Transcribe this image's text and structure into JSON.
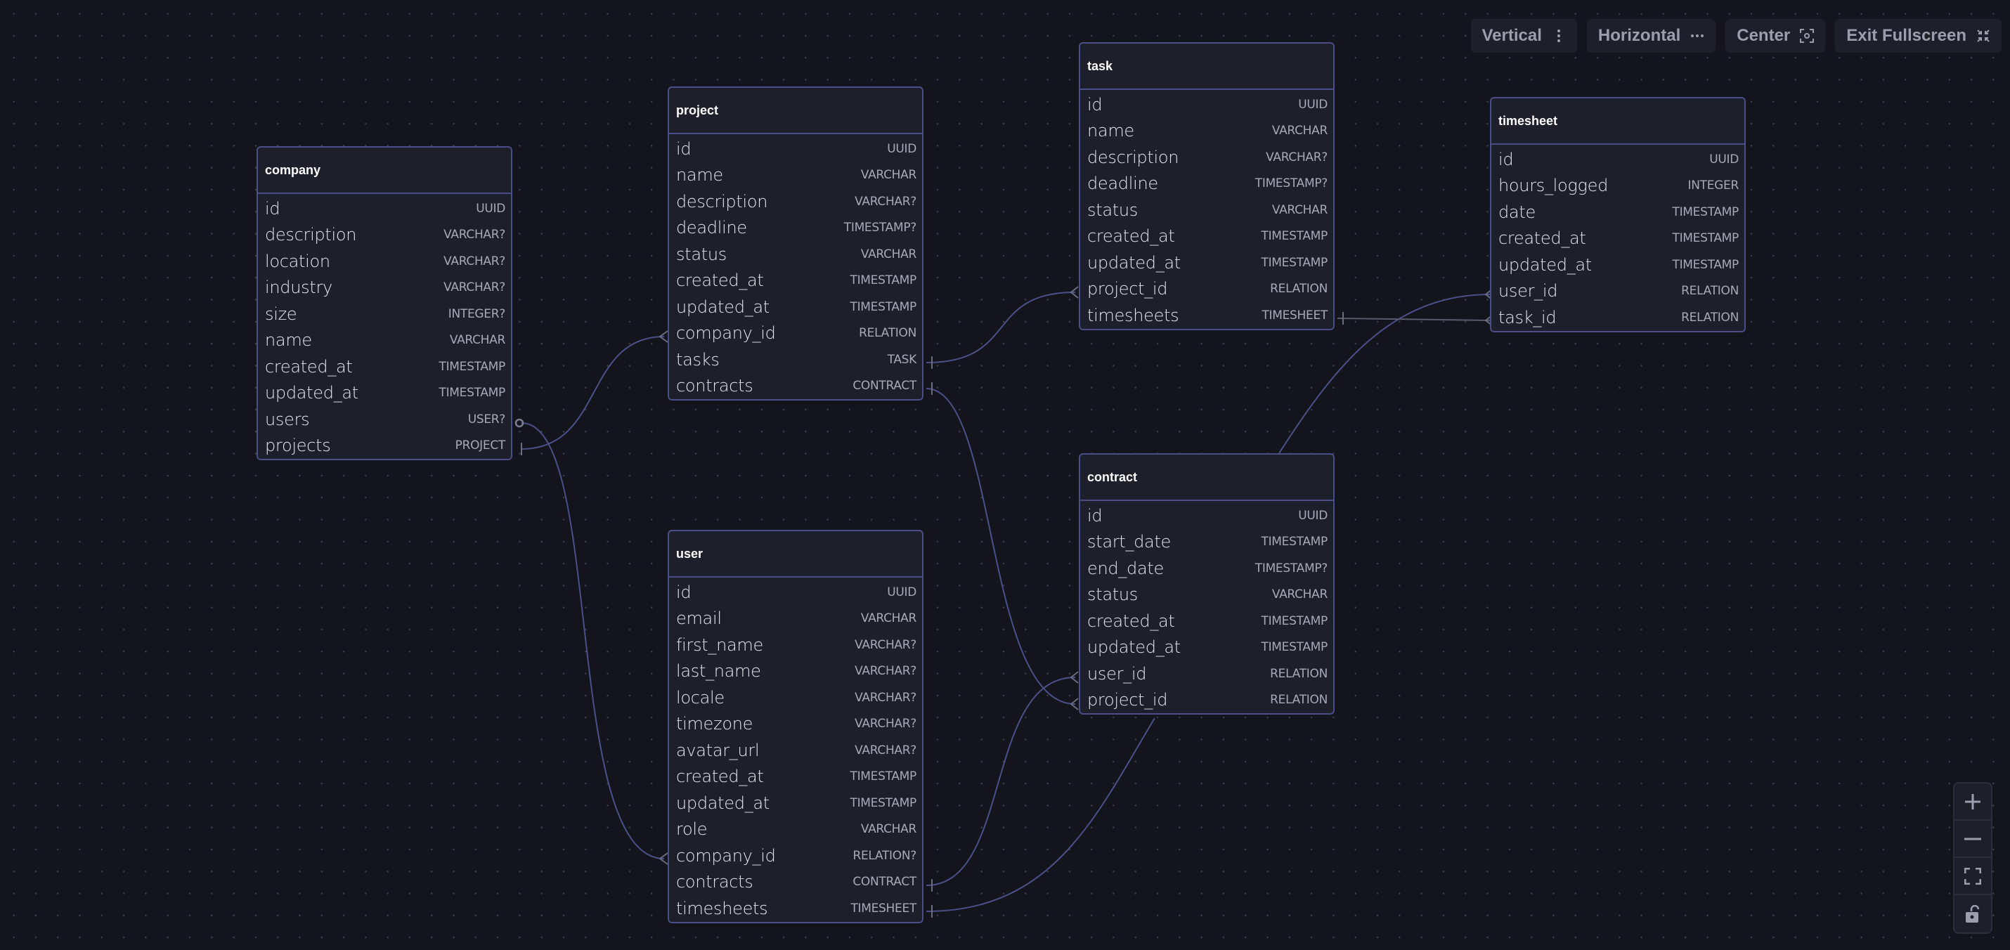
{
  "toolbar": {
    "vertical_label": "Vertical",
    "horizontal_label": "Horizontal",
    "center_label": "Center",
    "exit_fullscreen_label": "Exit Fullscreen",
    "icons": [
      "vertical-dots-icon",
      "horizontal-dots-icon",
      "focus-icon",
      "collapse-icon"
    ]
  },
  "zoom_controls": {
    "icons": [
      "zoom-in-icon",
      "zoom-out-icon",
      "fit-view-icon",
      "unlock-icon"
    ]
  },
  "colors": {
    "background": "#13141c",
    "table_bg": "#1d1f2b",
    "table_border": "#4a4e86",
    "edge": "#4b5088"
  },
  "tables": {
    "company": {
      "title": "company",
      "columns": [
        {
          "name": "id",
          "type": "UUID"
        },
        {
          "name": "description",
          "type": "VARCHAR?"
        },
        {
          "name": "location",
          "type": "VARCHAR?"
        },
        {
          "name": "industry",
          "type": "VARCHAR?"
        },
        {
          "name": "size",
          "type": "INTEGER?"
        },
        {
          "name": "name",
          "type": "VARCHAR"
        },
        {
          "name": "created_at",
          "type": "TIMESTAMP"
        },
        {
          "name": "updated_at",
          "type": "TIMESTAMP"
        },
        {
          "name": "users",
          "type": "USER?"
        },
        {
          "name": "projects",
          "type": "PROJECT"
        }
      ]
    },
    "project": {
      "title": "project",
      "columns": [
        {
          "name": "id",
          "type": "UUID"
        },
        {
          "name": "name",
          "type": "VARCHAR"
        },
        {
          "name": "description",
          "type": "VARCHAR?"
        },
        {
          "name": "deadline",
          "type": "TIMESTAMP?"
        },
        {
          "name": "status",
          "type": "VARCHAR"
        },
        {
          "name": "created_at",
          "type": "TIMESTAMP"
        },
        {
          "name": "updated_at",
          "type": "TIMESTAMP"
        },
        {
          "name": "company_id",
          "type": "RELATION"
        },
        {
          "name": "tasks",
          "type": "TASK"
        },
        {
          "name": "contracts",
          "type": "CONTRACT"
        }
      ]
    },
    "task": {
      "title": "task",
      "columns": [
        {
          "name": "id",
          "type": "UUID"
        },
        {
          "name": "name",
          "type": "VARCHAR"
        },
        {
          "name": "description",
          "type": "VARCHAR?"
        },
        {
          "name": "deadline",
          "type": "TIMESTAMP?"
        },
        {
          "name": "status",
          "type": "VARCHAR"
        },
        {
          "name": "created_at",
          "type": "TIMESTAMP"
        },
        {
          "name": "updated_at",
          "type": "TIMESTAMP"
        },
        {
          "name": "project_id",
          "type": "RELATION"
        },
        {
          "name": "timesheets",
          "type": "TIMESHEET"
        }
      ]
    },
    "timesheet": {
      "title": "timesheet",
      "columns": [
        {
          "name": "id",
          "type": "UUID"
        },
        {
          "name": "hours_logged",
          "type": "INTEGER"
        },
        {
          "name": "date",
          "type": "TIMESTAMP"
        },
        {
          "name": "created_at",
          "type": "TIMESTAMP"
        },
        {
          "name": "updated_at",
          "type": "TIMESTAMP"
        },
        {
          "name": "user_id",
          "type": "RELATION"
        },
        {
          "name": "task_id",
          "type": "RELATION"
        }
      ]
    },
    "user": {
      "title": "user",
      "columns": [
        {
          "name": "id",
          "type": "UUID"
        },
        {
          "name": "email",
          "type": "VARCHAR"
        },
        {
          "name": "first_name",
          "type": "VARCHAR?"
        },
        {
          "name": "last_name",
          "type": "VARCHAR?"
        },
        {
          "name": "locale",
          "type": "VARCHAR?"
        },
        {
          "name": "timezone",
          "type": "VARCHAR?"
        },
        {
          "name": "avatar_url",
          "type": "VARCHAR?"
        },
        {
          "name": "created_at",
          "type": "TIMESTAMP"
        },
        {
          "name": "updated_at",
          "type": "TIMESTAMP"
        },
        {
          "name": "role",
          "type": "VARCHAR"
        },
        {
          "name": "company_id",
          "type": "RELATION?"
        },
        {
          "name": "contracts",
          "type": "CONTRACT"
        },
        {
          "name": "timesheets",
          "type": "TIMESHEET"
        }
      ]
    },
    "contract": {
      "title": "contract",
      "columns": [
        {
          "name": "id",
          "type": "UUID"
        },
        {
          "name": "start_date",
          "type": "TIMESTAMP"
        },
        {
          "name": "end_date",
          "type": "TIMESTAMP?"
        },
        {
          "name": "status",
          "type": "VARCHAR"
        },
        {
          "name": "created_at",
          "type": "TIMESTAMP"
        },
        {
          "name": "updated_at",
          "type": "TIMESTAMP"
        },
        {
          "name": "user_id",
          "type": "RELATION"
        },
        {
          "name": "project_id",
          "type": "RELATION"
        }
      ]
    }
  },
  "relations": [
    {
      "from": "company.projects",
      "to": "project.company_id",
      "from_card": "one",
      "to_card": "many"
    },
    {
      "from": "company.users",
      "to": "user.company_id",
      "from_card": "zero-or-one",
      "to_card": "many"
    },
    {
      "from": "project.tasks",
      "to": "task.project_id",
      "from_card": "one",
      "to_card": "many"
    },
    {
      "from": "project.contracts",
      "to": "contract.project_id",
      "from_card": "one",
      "to_card": "many"
    },
    {
      "from": "task.timesheets",
      "to": "timesheet.task_id",
      "from_card": "one",
      "to_card": "many"
    },
    {
      "from": "user.contracts",
      "to": "contract.user_id",
      "from_card": "one",
      "to_card": "many"
    },
    {
      "from": "user.timesheets",
      "to": "timesheet.user_id",
      "from_card": "one",
      "to_card": "many"
    }
  ]
}
